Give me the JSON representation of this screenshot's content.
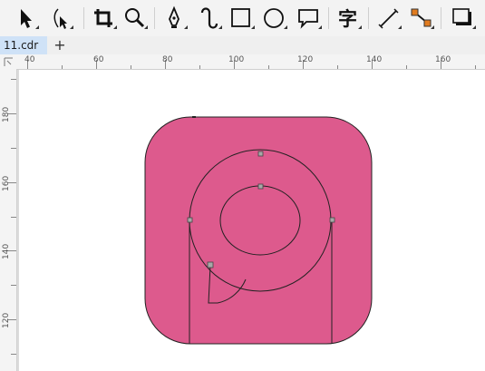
{
  "toolbar": {
    "tools": [
      {
        "icon": "pick-tool-icon"
      },
      {
        "icon": "shape-tool-icon"
      },
      {
        "icon": "crop-tool-icon"
      },
      {
        "icon": "zoom-tool-icon"
      },
      {
        "icon": "pen-tool-icon"
      },
      {
        "icon": "artistic-media-tool-icon"
      },
      {
        "icon": "rectangle-tool-icon"
      },
      {
        "icon": "ellipse-tool-icon"
      },
      {
        "icon": "callout-tool-icon"
      },
      {
        "icon": "text-tool-icon",
        "glyph": "字"
      },
      {
        "icon": "dimension-tool-icon"
      },
      {
        "icon": "connector-tool-icon"
      },
      {
        "icon": "drop-shadow-tool-icon"
      }
    ],
    "accent_color": "#e07b1f"
  },
  "tabs": {
    "active": "11.cdr",
    "add_label": "+"
  },
  "rulers": {
    "horizontal": [
      "40",
      "60",
      "80",
      "100",
      "120",
      "140",
      "160"
    ],
    "vertical": [
      "180",
      "160",
      "140",
      "120"
    ]
  },
  "artwork": {
    "fill_color": "#dd5a8d",
    "stroke_color": "#222222"
  }
}
